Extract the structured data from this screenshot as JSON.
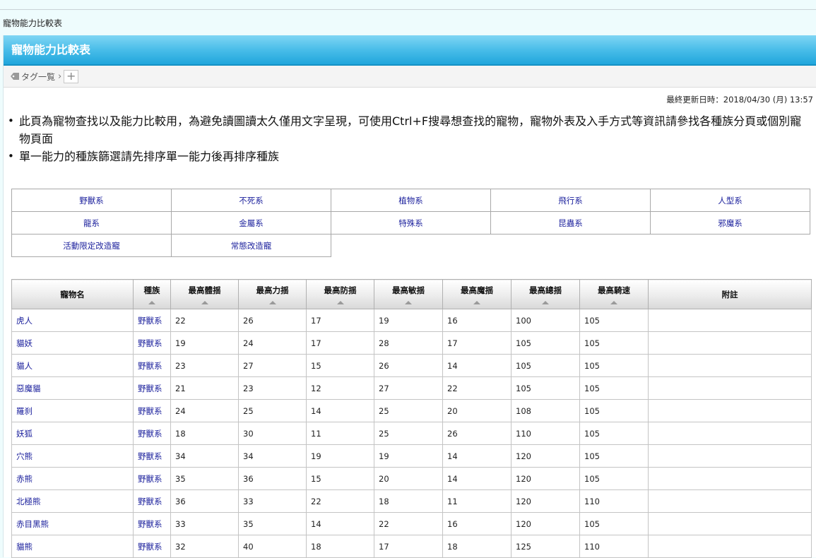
{
  "breadcrumb": "寵物能力比較表",
  "page_title": "寵物能力比較表",
  "tag_bar": {
    "tag_list_label": "タグ一覧",
    "separator": "›",
    "add_label": "+"
  },
  "last_updated": "最終更新日時：2018/04/30 (月) 13:57",
  "notes": [
    "此頁為寵物查找以及能力比較用，為避免讀圖讀太久僅用文字呈現，可使用Ctrl+F搜尋想查找的寵物，寵物外表及入手方式等資訊請參找各種族分頁或個別寵物頁面",
    "單一能力的種族篩選請先排序單一能力後再排序種族"
  ],
  "categories": [
    [
      "野獸系",
      "不死系",
      "植物系",
      "飛行系",
      "人型系"
    ],
    [
      "龍系",
      "金屬系",
      "特殊系",
      "昆蟲系",
      "邪魔系"
    ],
    [
      "活動限定改造寵",
      "常態改造寵",
      "",
      "",
      ""
    ]
  ],
  "table": {
    "headers": [
      "寵物名",
      "種族",
      "最高體揺",
      "最高力揺",
      "最高防揺",
      "最高敏揺",
      "最高魔揺",
      "最高總揺",
      "最高騎速",
      "附註"
    ],
    "rows": [
      [
        "虎人",
        "野獸系",
        "22",
        "26",
        "17",
        "19",
        "16",
        "100",
        "105",
        ""
      ],
      [
        "貓妖",
        "野獸系",
        "19",
        "24",
        "17",
        "28",
        "17",
        "105",
        "105",
        ""
      ],
      [
        "貓人",
        "野獸系",
        "23",
        "27",
        "15",
        "26",
        "14",
        "105",
        "105",
        ""
      ],
      [
        "惡魔貓",
        "野獸系",
        "21",
        "23",
        "12",
        "27",
        "22",
        "105",
        "105",
        ""
      ],
      [
        "羅刹",
        "野獸系",
        "24",
        "25",
        "14",
        "25",
        "20",
        "108",
        "105",
        ""
      ],
      [
        "妖狐",
        "野獸系",
        "18",
        "30",
        "11",
        "25",
        "26",
        "110",
        "105",
        ""
      ],
      [
        "穴熊",
        "野獸系",
        "34",
        "34",
        "19",
        "19",
        "14",
        "120",
        "105",
        ""
      ],
      [
        "赤熊",
        "野獸系",
        "35",
        "36",
        "15",
        "20",
        "14",
        "120",
        "105",
        ""
      ],
      [
        "北極熊",
        "野獸系",
        "36",
        "33",
        "22",
        "18",
        "11",
        "120",
        "110",
        ""
      ],
      [
        "赤目黑熊",
        "野獸系",
        "33",
        "35",
        "14",
        "22",
        "16",
        "120",
        "105",
        ""
      ],
      [
        "貓熊",
        "野獸系",
        "32",
        "40",
        "18",
        "17",
        "18",
        "125",
        "110",
        ""
      ]
    ]
  },
  "colors": {
    "title_bar": "#20a6dc",
    "link": "#1a1f9c",
    "page_bg": "#eefcfd"
  },
  "icons": {
    "tag": "tag-icon"
  }
}
